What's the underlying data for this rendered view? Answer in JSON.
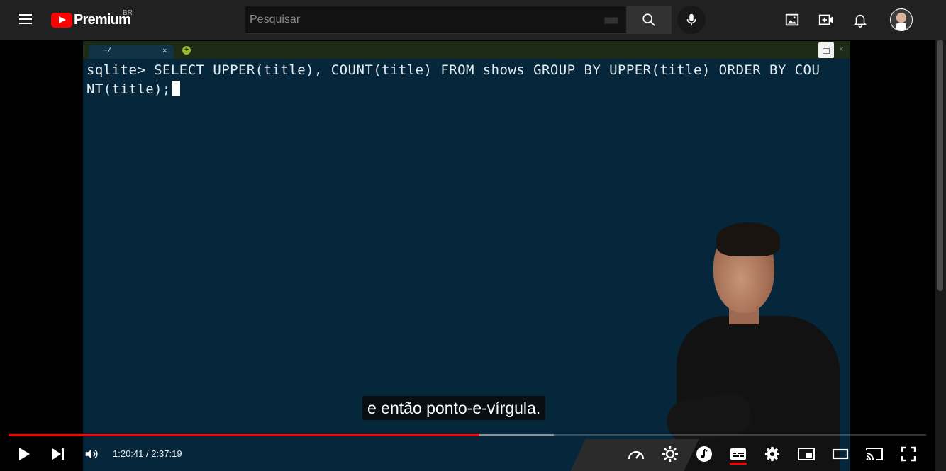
{
  "masthead": {
    "logo_text": "Premium",
    "country_code": "BR",
    "search_placeholder": "Pesquisar"
  },
  "terminal": {
    "tab_label": "~/",
    "tab_close": "×",
    "new_tab": "+",
    "window_close": "×",
    "line1": "sqlite> SELECT UPPER(title), COUNT(title) FROM shows GROUP BY UPPER(title) ORDER BY COU",
    "line2": "NT(title);"
  },
  "caption": "e então ponto-e-vírgula.",
  "player": {
    "time": "1:20:41 / 2:37:19",
    "played_fraction": 0.513,
    "loaded_fraction": 0.594
  },
  "colors": {
    "brand_red": "#ff0000",
    "terminal_bg": "#05263b"
  }
}
